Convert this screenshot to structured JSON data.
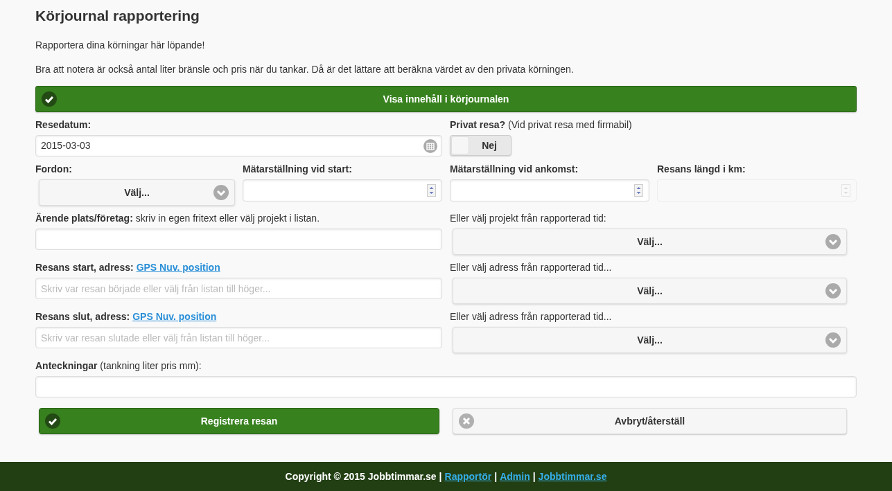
{
  "title": "Körjournal rapportering",
  "intro": [
    "Rapportera dina körningar här löpande!",
    "Bra att notera är också antal liter bränsle och pris när du tankar. Då är det lättare att beräkna värdet av den privata körningen."
  ],
  "toggle_bar": {
    "label": "Visa innehåll i körjournalen"
  },
  "rows": [
    {
      "cells": [
        {
          "kind": "date",
          "label": "**Resedatum:**",
          "value": "2015-03-03"
        },
        {
          "kind": "toggle",
          "label": "**Privat resa?** (Vid privat resa med firmabil)",
          "on": false,
          "text": "Nej"
        }
      ]
    },
    {
      "cells": [
        {
          "kind": "select",
          "label": "**Fordon:**",
          "value": "Välj..."
        },
        {
          "kind": "number",
          "label": "**Mätarställning vid start:**",
          "disabled": false
        },
        {
          "kind": "number",
          "label": "**Mätarställning vid ankomst:**",
          "disabled": false
        },
        {
          "kind": "number",
          "label": "**Resans längd i km:**",
          "disabled": true
        }
      ]
    },
    {
      "cells": [
        {
          "kind": "text",
          "label": "**Ärende plats/företag:** skriv in egen fritext eller välj projekt i listan."
        },
        {
          "kind": "select",
          "label": "Eller välj projekt från rapporterad tid:",
          "value": "Välj..."
        }
      ]
    },
    {
      "cells": [
        {
          "kind": "text",
          "label": "**Resans start, adress:**",
          "link": "GPS Nuv. position",
          "placeholder": "Skriv var resan började eller välj från listan till höger..."
        },
        {
          "kind": "select",
          "label": "Eller välj adress från rapporterad tid...",
          "value": "Välj..."
        }
      ]
    },
    {
      "cells": [
        {
          "kind": "text",
          "label": "**Resans slut, adress:**",
          "link": "GPS Nuv. position",
          "placeholder": "Skriv var resan slutade eller välj från listan till höger..."
        },
        {
          "kind": "select",
          "label": "Eller välj adress från rapporterad tid...",
          "value": "Välj..."
        }
      ]
    },
    {
      "cells": [
        {
          "kind": "text",
          "label": "**Anteckningar** (tankning liter pris mm):"
        }
      ]
    }
  ],
  "buttons": [
    {
      "kind": "primary",
      "label": "Registrera resan"
    },
    {
      "kind": "secondary",
      "label": "Avbryt/återställ"
    }
  ],
  "footer": [
    {
      "kind": "text",
      "text": "Copyright © 2015 Jobbtimmar.se"
    },
    {
      "kind": "text",
      "text": "|"
    },
    {
      "kind": "link",
      "text": "Rapportör"
    },
    {
      "kind": "text",
      "text": "|"
    },
    {
      "kind": "link",
      "text": "Admin"
    },
    {
      "kind": "text",
      "text": "|"
    },
    {
      "kind": "link",
      "text": "Jobbtimmar.se"
    }
  ]
}
